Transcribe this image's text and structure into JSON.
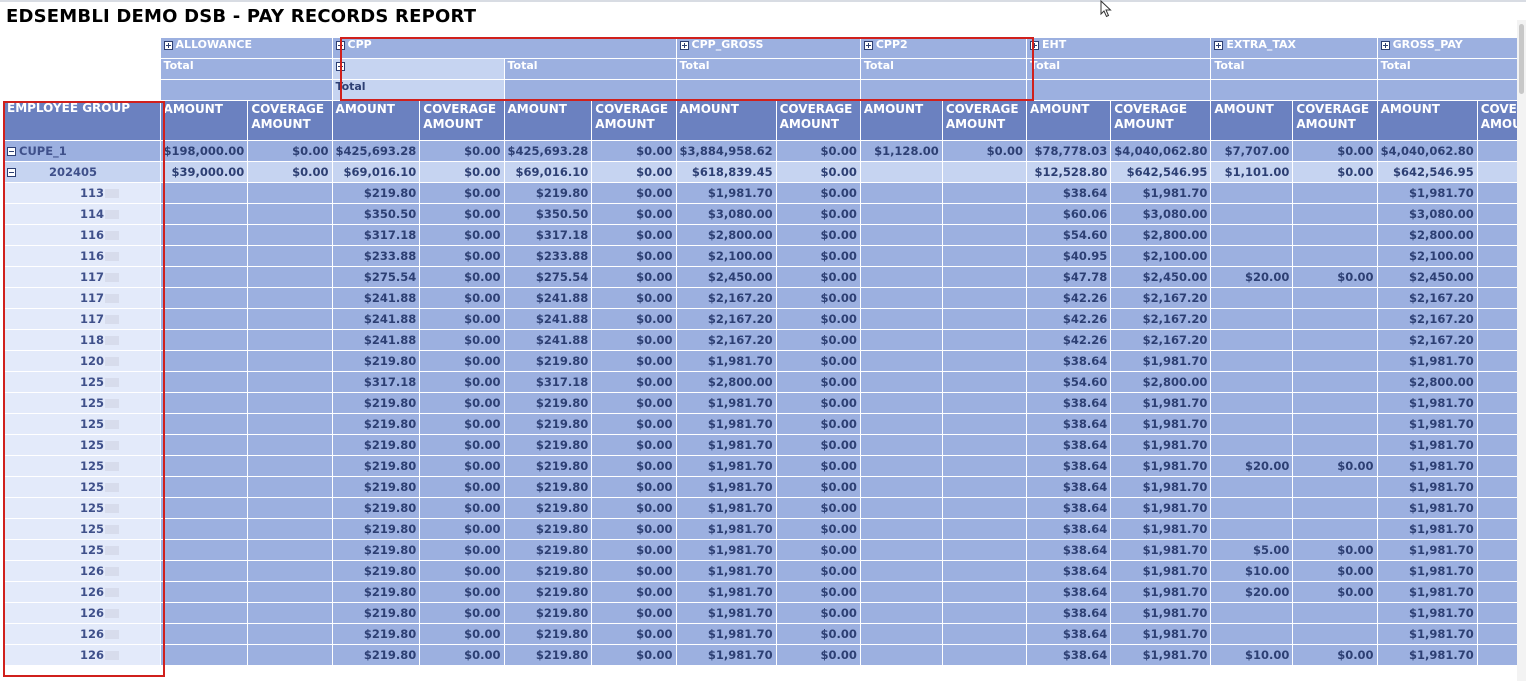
{
  "report": {
    "title": "EDSEMBLI DEMO DSB - PAY RECORDS REPORT"
  },
  "header": {
    "groups": [
      "ALLOWANCE",
      "CPP",
      "CPP_GROSS",
      "CPP2",
      "EHT",
      "EXTRA_TAX",
      "GROSS_PAY"
    ],
    "total": "Total",
    "row_field_label": "EMPLOYEE GROUP",
    "amount": "AMOUNT",
    "coverage_amount_line1": "COVERAGE",
    "coverage_amount_line2": "AMOUNT",
    "last_partial": "COVE",
    "last_partial2": "AMOU"
  },
  "rows": [
    {
      "label": "CUPE_1",
      "cells": [
        "$198,000.00",
        "$0.00",
        "$425,693.28",
        "$0.00",
        "$425,693.28",
        "$0.00",
        "$3,884,958.62",
        "$0.00",
        "$1,128.00",
        "$0.00",
        "$78,778.03",
        "$4,040,062.80",
        "$7,707.00",
        "$0.00",
        "$4,040,062.80"
      ]
    },
    {
      "label": "202405",
      "cells": [
        "$39,000.00",
        "$0.00",
        "$69,016.10",
        "$0.00",
        "$69,016.10",
        "$0.00",
        "$618,839.45",
        "$0.00",
        "",
        "",
        "$12,528.80",
        "$642,546.95",
        "$1,101.00",
        "$0.00",
        "$642,546.95"
      ]
    },
    {
      "label": "113",
      "cells": [
        "",
        "",
        "$219.80",
        "$0.00",
        "$219.80",
        "$0.00",
        "$1,981.70",
        "$0.00",
        "",
        "",
        "$38.64",
        "$1,981.70",
        "",
        "",
        "$1,981.70"
      ]
    },
    {
      "label": "114",
      "cells": [
        "",
        "",
        "$350.50",
        "$0.00",
        "$350.50",
        "$0.00",
        "$3,080.00",
        "$0.00",
        "",
        "",
        "$60.06",
        "$3,080.00",
        "",
        "",
        "$3,080.00"
      ]
    },
    {
      "label": "116",
      "cells": [
        "",
        "",
        "$317.18",
        "$0.00",
        "$317.18",
        "$0.00",
        "$2,800.00",
        "$0.00",
        "",
        "",
        "$54.60",
        "$2,800.00",
        "",
        "",
        "$2,800.00"
      ]
    },
    {
      "label": "116",
      "cells": [
        "",
        "",
        "$233.88",
        "$0.00",
        "$233.88",
        "$0.00",
        "$2,100.00",
        "$0.00",
        "",
        "",
        "$40.95",
        "$2,100.00",
        "",
        "",
        "$2,100.00"
      ]
    },
    {
      "label": "117",
      "cells": [
        "",
        "",
        "$275.54",
        "$0.00",
        "$275.54",
        "$0.00",
        "$2,450.00",
        "$0.00",
        "",
        "",
        "$47.78",
        "$2,450.00",
        "$20.00",
        "$0.00",
        "$2,450.00"
      ]
    },
    {
      "label": "117",
      "cells": [
        "",
        "",
        "$241.88",
        "$0.00",
        "$241.88",
        "$0.00",
        "$2,167.20",
        "$0.00",
        "",
        "",
        "$42.26",
        "$2,167.20",
        "",
        "",
        "$2,167.20"
      ]
    },
    {
      "label": "117",
      "cells": [
        "",
        "",
        "$241.88",
        "$0.00",
        "$241.88",
        "$0.00",
        "$2,167.20",
        "$0.00",
        "",
        "",
        "$42.26",
        "$2,167.20",
        "",
        "",
        "$2,167.20"
      ]
    },
    {
      "label": "118",
      "cells": [
        "",
        "",
        "$241.88",
        "$0.00",
        "$241.88",
        "$0.00",
        "$2,167.20",
        "$0.00",
        "",
        "",
        "$42.26",
        "$2,167.20",
        "",
        "",
        "$2,167.20"
      ]
    },
    {
      "label": "120",
      "cells": [
        "",
        "",
        "$219.80",
        "$0.00",
        "$219.80",
        "$0.00",
        "$1,981.70",
        "$0.00",
        "",
        "",
        "$38.64",
        "$1,981.70",
        "",
        "",
        "$1,981.70"
      ]
    },
    {
      "label": "125",
      "cells": [
        "",
        "",
        "$317.18",
        "$0.00",
        "$317.18",
        "$0.00",
        "$2,800.00",
        "$0.00",
        "",
        "",
        "$54.60",
        "$2,800.00",
        "",
        "",
        "$2,800.00"
      ]
    },
    {
      "label": "125",
      "cells": [
        "",
        "",
        "$219.80",
        "$0.00",
        "$219.80",
        "$0.00",
        "$1,981.70",
        "$0.00",
        "",
        "",
        "$38.64",
        "$1,981.70",
        "",
        "",
        "$1,981.70"
      ]
    },
    {
      "label": "125",
      "cells": [
        "",
        "",
        "$219.80",
        "$0.00",
        "$219.80",
        "$0.00",
        "$1,981.70",
        "$0.00",
        "",
        "",
        "$38.64",
        "$1,981.70",
        "",
        "",
        "$1,981.70"
      ]
    },
    {
      "label": "125",
      "cells": [
        "",
        "",
        "$219.80",
        "$0.00",
        "$219.80",
        "$0.00",
        "$1,981.70",
        "$0.00",
        "",
        "",
        "$38.64",
        "$1,981.70",
        "",
        "",
        "$1,981.70"
      ]
    },
    {
      "label": "125",
      "cells": [
        "",
        "",
        "$219.80",
        "$0.00",
        "$219.80",
        "$0.00",
        "$1,981.70",
        "$0.00",
        "",
        "",
        "$38.64",
        "$1,981.70",
        "$20.00",
        "$0.00",
        "$1,981.70"
      ]
    },
    {
      "label": "125",
      "cells": [
        "",
        "",
        "$219.80",
        "$0.00",
        "$219.80",
        "$0.00",
        "$1,981.70",
        "$0.00",
        "",
        "",
        "$38.64",
        "$1,981.70",
        "",
        "",
        "$1,981.70"
      ]
    },
    {
      "label": "125",
      "cells": [
        "",
        "",
        "$219.80",
        "$0.00",
        "$219.80",
        "$0.00",
        "$1,981.70",
        "$0.00",
        "",
        "",
        "$38.64",
        "$1,981.70",
        "",
        "",
        "$1,981.70"
      ]
    },
    {
      "label": "125",
      "cells": [
        "",
        "",
        "$219.80",
        "$0.00",
        "$219.80",
        "$0.00",
        "$1,981.70",
        "$0.00",
        "",
        "",
        "$38.64",
        "$1,981.70",
        "",
        "",
        "$1,981.70"
      ]
    },
    {
      "label": "125",
      "cells": [
        "",
        "",
        "$219.80",
        "$0.00",
        "$219.80",
        "$0.00",
        "$1,981.70",
        "$0.00",
        "",
        "",
        "$38.64",
        "$1,981.70",
        "$5.00",
        "$0.00",
        "$1,981.70"
      ]
    },
    {
      "label": "126",
      "cells": [
        "",
        "",
        "$219.80",
        "$0.00",
        "$219.80",
        "$0.00",
        "$1,981.70",
        "$0.00",
        "",
        "",
        "$38.64",
        "$1,981.70",
        "$10.00",
        "$0.00",
        "$1,981.70"
      ]
    },
    {
      "label": "126",
      "cells": [
        "",
        "",
        "$219.80",
        "$0.00",
        "$219.80",
        "$0.00",
        "$1,981.70",
        "$0.00",
        "",
        "",
        "$38.64",
        "$1,981.70",
        "$20.00",
        "$0.00",
        "$1,981.70"
      ]
    },
    {
      "label": "126",
      "cells": [
        "",
        "",
        "$219.80",
        "$0.00",
        "$219.80",
        "$0.00",
        "$1,981.70",
        "$0.00",
        "",
        "",
        "$38.64",
        "$1,981.70",
        "",
        "",
        "$1,981.70"
      ]
    },
    {
      "label": "126",
      "cells": [
        "",
        "",
        "$219.80",
        "$0.00",
        "$219.80",
        "$0.00",
        "$1,981.70",
        "$0.00",
        "",
        "",
        "$38.64",
        "$1,981.70",
        "",
        "",
        "$1,981.70"
      ]
    },
    {
      "label": "126",
      "cells": [
        "",
        "",
        "$219.80",
        "$0.00",
        "$219.80",
        "$0.00",
        "$1,981.70",
        "$0.00",
        "",
        "",
        "$38.64",
        "$1,981.70",
        "$10.00",
        "$0.00",
        "$1,981.70"
      ]
    }
  ],
  "colors": {
    "header_dark": "#6b81c0",
    "header_mid": "#9cb0e0",
    "header_light": "#c6d4f1",
    "row_label_bg": "#e3eafa",
    "highlight_border": "#d0201c"
  }
}
